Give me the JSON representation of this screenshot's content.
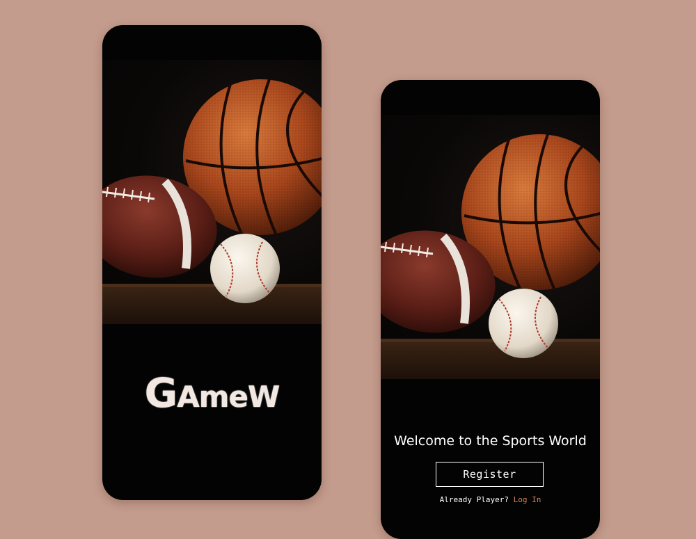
{
  "splash": {
    "image_alt": "sports balls on wooden shelf",
    "logo_first": "G",
    "logo_rest": "AmeW"
  },
  "welcome": {
    "image_alt": "sports balls on wooden shelf",
    "title": "Welcome to the Sports World",
    "register_label": "Register",
    "already_player": "Already Player?",
    "login_label": "Log In"
  },
  "colors": {
    "background": "#c49c8d",
    "phone": "#030303",
    "link": "#d9885a"
  }
}
